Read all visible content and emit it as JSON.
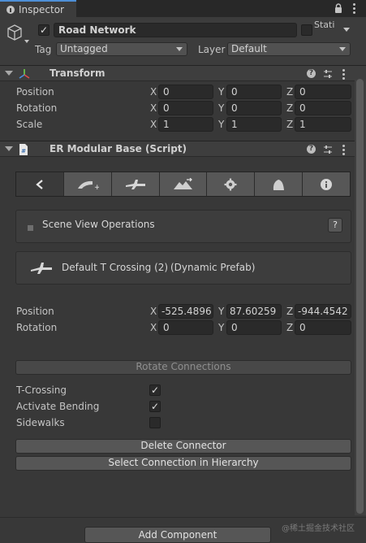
{
  "window": {
    "tab_title": "Inspector",
    "lock_icon": "lock-icon",
    "menu_icon": "kebab-menu-icon"
  },
  "object": {
    "name": "Road Network",
    "active": true,
    "static_label": "Static",
    "tag_label": "Tag",
    "tag_value": "Untagged",
    "layer_label": "Layer",
    "layer_value": "Default"
  },
  "transform": {
    "title": "Transform",
    "position": {
      "label": "Position",
      "x": "0",
      "y": "0",
      "z": "0"
    },
    "rotation": {
      "label": "Rotation",
      "x": "0",
      "y": "0",
      "z": "0"
    },
    "scale": {
      "label": "Scale",
      "x": "1",
      "y": "1",
      "z": "1"
    }
  },
  "script": {
    "title": "ER Modular Base (Script)",
    "toolbar_icons": [
      "back-arrow-icon",
      "add-road-icon",
      "connector-icon",
      "terrain-icon",
      "settings-gear-icon",
      "prefab-icon",
      "info-icon"
    ],
    "scene_ops_label": "Scene View Operations",
    "scene_ops_help": "?",
    "prefab_name": "Default T Crossing (2)",
    "prefab_type": "(Dynamic Prefab)",
    "position": {
      "label": "Position",
      "x": "-525.4896",
      "y": "87.60259",
      "z": "-944.4542"
    },
    "rotation": {
      "label": "Rotation",
      "x": "0",
      "y": "0",
      "z": "0"
    },
    "rotate_connections": "Rotate Connections",
    "toggles": [
      {
        "label": "T-Crossing",
        "checked": true
      },
      {
        "label": "Activate Bending",
        "checked": true
      },
      {
        "label": "Sidewalks",
        "checked": false
      }
    ],
    "delete_connector": "Delete Connector",
    "select_connection": "Select Connection in Hierarchy"
  },
  "axes": {
    "x": "X",
    "y": "Y",
    "z": "Z"
  },
  "footer": {
    "add_component": "Add Component",
    "watermark": "@稀土掘金技术社区"
  },
  "colors": {
    "accent": "#4e8fd6",
    "background": "#383838",
    "field": "#2a2a2a"
  }
}
